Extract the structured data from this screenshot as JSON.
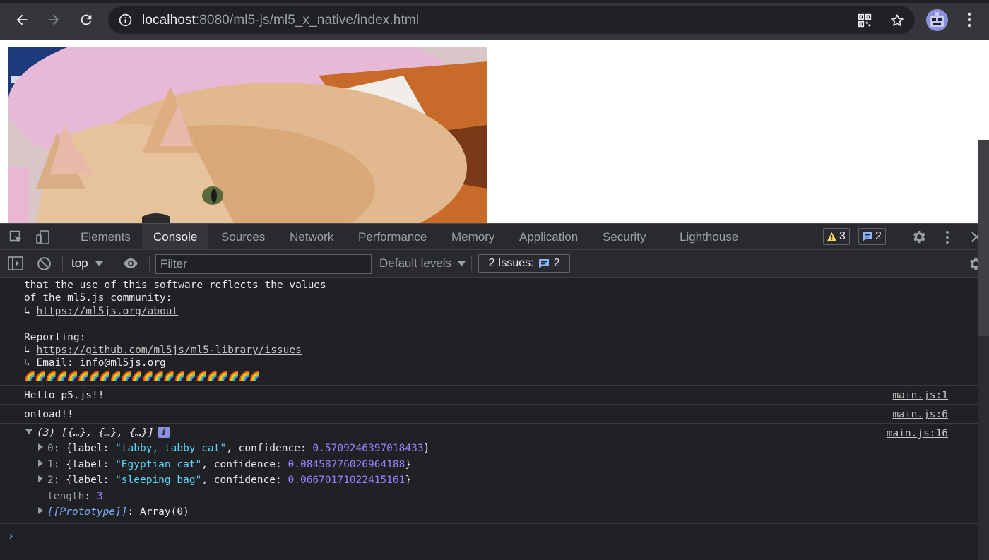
{
  "browser": {
    "url_host": "localhost",
    "url_rest": ":8080/ml5-js/ml5_x_native/index.html",
    "icons": [
      "back-arrow-icon",
      "forward-arrow-icon",
      "reload-icon",
      "info-icon",
      "qr-code-icon",
      "star-icon",
      "avatar",
      "kebab-menu-icon"
    ]
  },
  "page": {
    "image": "cat-photo"
  },
  "devtools": {
    "tabs": [
      "Elements",
      "Console",
      "Sources",
      "Network",
      "Performance",
      "Memory",
      "Application",
      "Security",
      "Lighthouse"
    ],
    "active_tab": "Console",
    "warnings_count": "3",
    "messages_count": "2",
    "toolbar": {
      "context": "top",
      "filter_placeholder": "Filter",
      "levels": "Default levels",
      "issues_label": "2 Issues:",
      "issues_count": "2"
    }
  },
  "console": {
    "intro_lines": [
      "that the use of this software reflects the values",
      "of the ml5.js community:"
    ],
    "about_link": "https://ml5js.org/about",
    "reporting": "Reporting:",
    "issues_link": "https://github.com/ml5js/ml5-library/issues",
    "email": "↳ Email: info@ml5js.org",
    "arrow": "↳ ",
    "rainbow": "🌈🌈🌈🌈🌈🌈🌈🌈🌈🌈🌈🌈🌈🌈🌈🌈🌈🌈🌈🌈🌈🌈",
    "messages": [
      {
        "text": "Hello p5.js!!",
        "source": "main.js:1"
      },
      {
        "text": "onload!!",
        "source": "main.js:6"
      }
    ],
    "array": {
      "summary": "(3) [{…}, {…}, {…}]",
      "source": "main.js:16",
      "items": [
        {
          "index": "0",
          "label": "\"tabby, tabby cat\"",
          "confidence": "0.5709246397018433"
        },
        {
          "index": "1",
          "label": "\"Egyptian cat\"",
          "confidence": "0.08458776026964188"
        },
        {
          "index": "2",
          "label": "\"sleeping bag\"",
          "confidence": "0.06670171022415161"
        }
      ],
      "length_key": "length",
      "length_value": "3",
      "prototype_key": "[[Prototype]]",
      "prototype_value": "Array(0)"
    },
    "prompt_caret": "›"
  }
}
